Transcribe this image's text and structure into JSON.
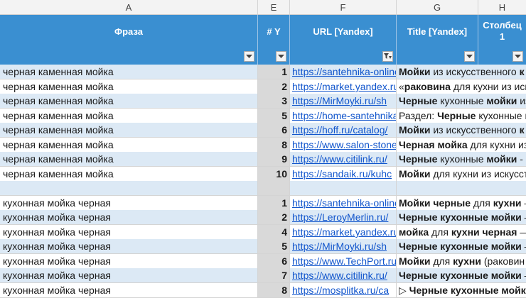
{
  "columns": {
    "A": "A",
    "E": "E",
    "F": "F",
    "G": "G",
    "H": "H"
  },
  "headers": {
    "phrase": "Фраза",
    "pos": "# Y",
    "url": "URL [Yandex]",
    "title": "Title [Yandex]",
    "extra": "Столбец 1"
  },
  "rows": [
    {
      "phrase": "черная каменная мойка",
      "pos": "1",
      "url": "https://santehnika-online",
      "title": [
        [
          "Мойки",
          true
        ],
        [
          " из искусственного ",
          false
        ],
        [
          "к",
          true
        ]
      ]
    },
    {
      "phrase": "черная каменная мойка",
      "pos": "2",
      "url": "https://market.yandex.ru",
      "title": [
        [
          "«",
          false
        ],
        [
          "раковина",
          true
        ],
        [
          " для кухни из иск",
          false
        ]
      ]
    },
    {
      "phrase": "черная каменная мойка",
      "pos": "3",
      "url": "https://MirMoyki.ru/sh",
      "title": [
        [
          "Черные",
          true
        ],
        [
          " кухонные ",
          false
        ],
        [
          "мойки",
          true
        ],
        [
          " из",
          false
        ]
      ]
    },
    {
      "phrase": "черная каменная мойка",
      "pos": "5",
      "url": "https://home-santehnika",
      "title": [
        [
          "Раздел: ",
          false
        ],
        [
          "Черные",
          true
        ],
        [
          " кухонные ",
          false
        ],
        [
          "м",
          true
        ]
      ]
    },
    {
      "phrase": "черная каменная мойка",
      "pos": "6",
      "url": "https://hoff.ru/catalog/",
      "title": [
        [
          "Мойки",
          true
        ],
        [
          " из искусственного ",
          false
        ],
        [
          "к",
          true
        ]
      ]
    },
    {
      "phrase": "черная каменная мойка",
      "pos": "8",
      "url": "https://www.salon-stone",
      "title": [
        [
          "Черная мойка",
          true
        ],
        [
          " для кухни из",
          false
        ]
      ]
    },
    {
      "phrase": "черная каменная мойка",
      "pos": "9",
      "url": "https://www.citilink.ru/",
      "title": [
        [
          "Черные",
          true
        ],
        [
          " кухонные ",
          false
        ],
        [
          "мойки",
          true
        ],
        [
          " - ц",
          false
        ]
      ]
    },
    {
      "phrase": "черная каменная мойка",
      "pos": "10",
      "url": "https://sandaik.ru/kuhc",
      "title": [
        [
          "Мойки",
          true
        ],
        [
          " для кухни из искусст",
          false
        ]
      ]
    },
    {
      "phrase": "",
      "pos": "",
      "url": "",
      "title": []
    },
    {
      "phrase": "кухонная мойка черная",
      "pos": "1",
      "url": "https://santehnika-online",
      "title": [
        [
          "Мойки черные",
          true
        ],
        [
          " для ",
          false
        ],
        [
          "кухни",
          true
        ],
        [
          " –",
          false
        ]
      ]
    },
    {
      "phrase": "кухонная мойка черная",
      "pos": "2",
      "url": "https://LeroyMerlin.ru/",
      "title": [
        [
          "Черные кухонные мойки",
          true
        ],
        [
          " –",
          false
        ]
      ]
    },
    {
      "phrase": "кухонная мойка черная",
      "pos": "4",
      "url": "https://market.yandex.ru",
      "title": [
        [
          "мойка",
          true
        ],
        [
          " для ",
          false
        ],
        [
          "кухни черная",
          true
        ],
        [
          " —",
          false
        ]
      ]
    },
    {
      "phrase": "кухонная мойка черная",
      "pos": "5",
      "url": "https://MirMoyki.ru/sh",
      "title": [
        [
          "Черные кухонные мойки",
          true
        ],
        [
          " –",
          false
        ]
      ]
    },
    {
      "phrase": "кухонная мойка черная",
      "pos": "6",
      "url": "https://www.TechPort.ru",
      "title": [
        [
          "Мойки",
          true
        ],
        [
          " для ",
          false
        ],
        [
          "кухни",
          true
        ],
        [
          " (раковин",
          false
        ]
      ]
    },
    {
      "phrase": "кухонная мойка черная",
      "pos": "7",
      "url": "https://www.citilink.ru/",
      "title": [
        [
          "Черные кухонные мойки",
          true
        ],
        [
          " –",
          false
        ]
      ]
    },
    {
      "phrase": "кухонная мойка черная",
      "pos": "8",
      "url": "https://mosplitka.ru/ca",
      "title": [
        [
          "▷ ",
          false
        ],
        [
          "Черные кухонные мойки",
          true
        ]
      ]
    }
  ]
}
